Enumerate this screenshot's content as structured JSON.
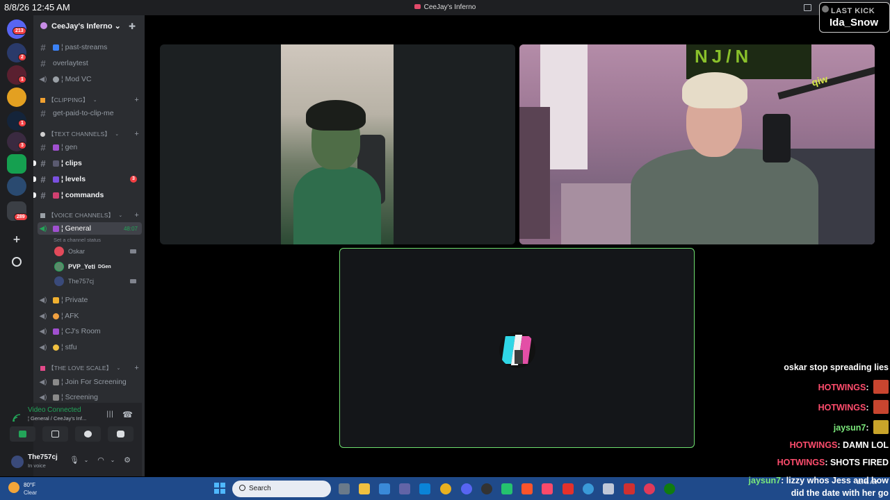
{
  "titlebar": {
    "clock": "8/8/26 12:45 AM",
    "window_title": "CeeJay's Inferno"
  },
  "last_kick": {
    "label": "LAST KICK",
    "name": "Ida_Snow"
  },
  "rail": {
    "badges": [
      "213",
      "2",
      "1",
      "1",
      "3",
      "289"
    ]
  },
  "sidebar": {
    "server_name": "CeeJay's Inferno ⌄",
    "channels_top": [
      {
        "label": "¦ past-streams"
      },
      {
        "label": "overlaytest"
      },
      {
        "label": "¦ Mod VC"
      }
    ],
    "categories": {
      "clipping": "【CLIPPING】",
      "text": "【TEXT CHANNELS】",
      "voice": "【VOICE CHANNELS】",
      "love": "【THE LOVE SCALE】"
    },
    "clipping_channels": [
      {
        "label": "get-paid-to-clip-me"
      }
    ],
    "text_channels": [
      {
        "label": "¦ gen"
      },
      {
        "label": "¦ clips"
      },
      {
        "label": "¦ levels",
        "unread": "3"
      },
      {
        "label": "¦ commands"
      }
    ],
    "voice_channels": {
      "general": {
        "label": "¦ General",
        "timer": "48:07",
        "status_hint": "Set a channel status"
      },
      "members": [
        {
          "name": "Oskar"
        },
        {
          "name": "PVP_Yeti",
          "tag": "DGen"
        },
        {
          "name": "The757cj"
        }
      ],
      "others": [
        {
          "label": "¦ Private"
        },
        {
          "label": "¦ AFK"
        },
        {
          "label": "¦ CJ's Room"
        },
        {
          "label": "¦ stfu"
        }
      ]
    },
    "love_channels": [
      {
        "label": "¦ Join For Screening"
      },
      {
        "label": "¦ Screening"
      }
    ]
  },
  "voice_panel": {
    "status": "Video Connected",
    "location": "¦ General / CeeJay's Inf...",
    "username": "The757cj",
    "user_status": "In voice"
  },
  "video": {
    "right_tile_poster": "NJ/N",
    "right_tile_boom": "qiw"
  },
  "chat": [
    {
      "user": "",
      "text": "oskar stop spreading lies"
    },
    {
      "user": "HOTWINGS",
      "text": "",
      "user_color": "#ff4d6d",
      "avatar": true
    },
    {
      "user": "HOTWINGS",
      "text": "",
      "user_color": "#ff4d6d",
      "avatar": true
    },
    {
      "user": "jaysun7",
      "text": "",
      "user_color": "#7be87b",
      "avatar": true
    },
    {
      "user": "HOTWINGS",
      "text": "DAMN LOL",
      "user_color": "#ff4d6d"
    },
    {
      "user": "HOTWINGS",
      "text": "SHOTS FIRED",
      "user_color": "#ff4d6d"
    },
    {
      "user": "jaysun7",
      "text": "lizzy whos Jess and how",
      "user_color": "#7be87b"
    }
  ],
  "chat_continuation": "did the date with her go",
  "taskbar": {
    "weather_temp": "80°F",
    "weather_cond": "Clear",
    "search_label": "Search",
    "time": "12:45 AM"
  },
  "colors": {
    "discord_bg": "#2b2d31",
    "rail_bg": "#1e1f22",
    "voice_green": "#23a559",
    "speaking_border": "#6ee06e",
    "taskbar_blue": "#1f4a8a"
  }
}
